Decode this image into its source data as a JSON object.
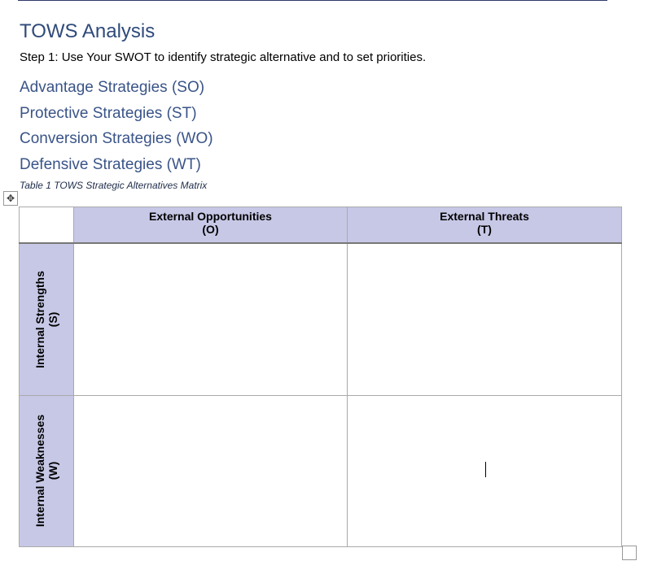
{
  "title": "TOWS Analysis",
  "step": "Step 1: Use Your SWOT to identify strategic alternative and to set priorities.",
  "strategies": [
    "Advantage Strategies (SO)",
    "Protective Strategies (ST)",
    "Conversion Strategies (WO)",
    "Defensive Strategies (WT)"
  ],
  "caption": "Table 1 TOWS Strategic Alternatives Matrix",
  "table": {
    "col1": {
      "line1": "External Opportunities",
      "line2": "(O)"
    },
    "col2": {
      "line1": "External Threats",
      "line2": "(T)"
    },
    "row1": {
      "line1": "Internal Strengths",
      "line2": "(S)"
    },
    "row2": {
      "line1": "Internal Weaknesses",
      "line2": "(W)"
    }
  },
  "colors": {
    "header_fill": "#c7c8e6",
    "heading": "#2f4a7a"
  }
}
